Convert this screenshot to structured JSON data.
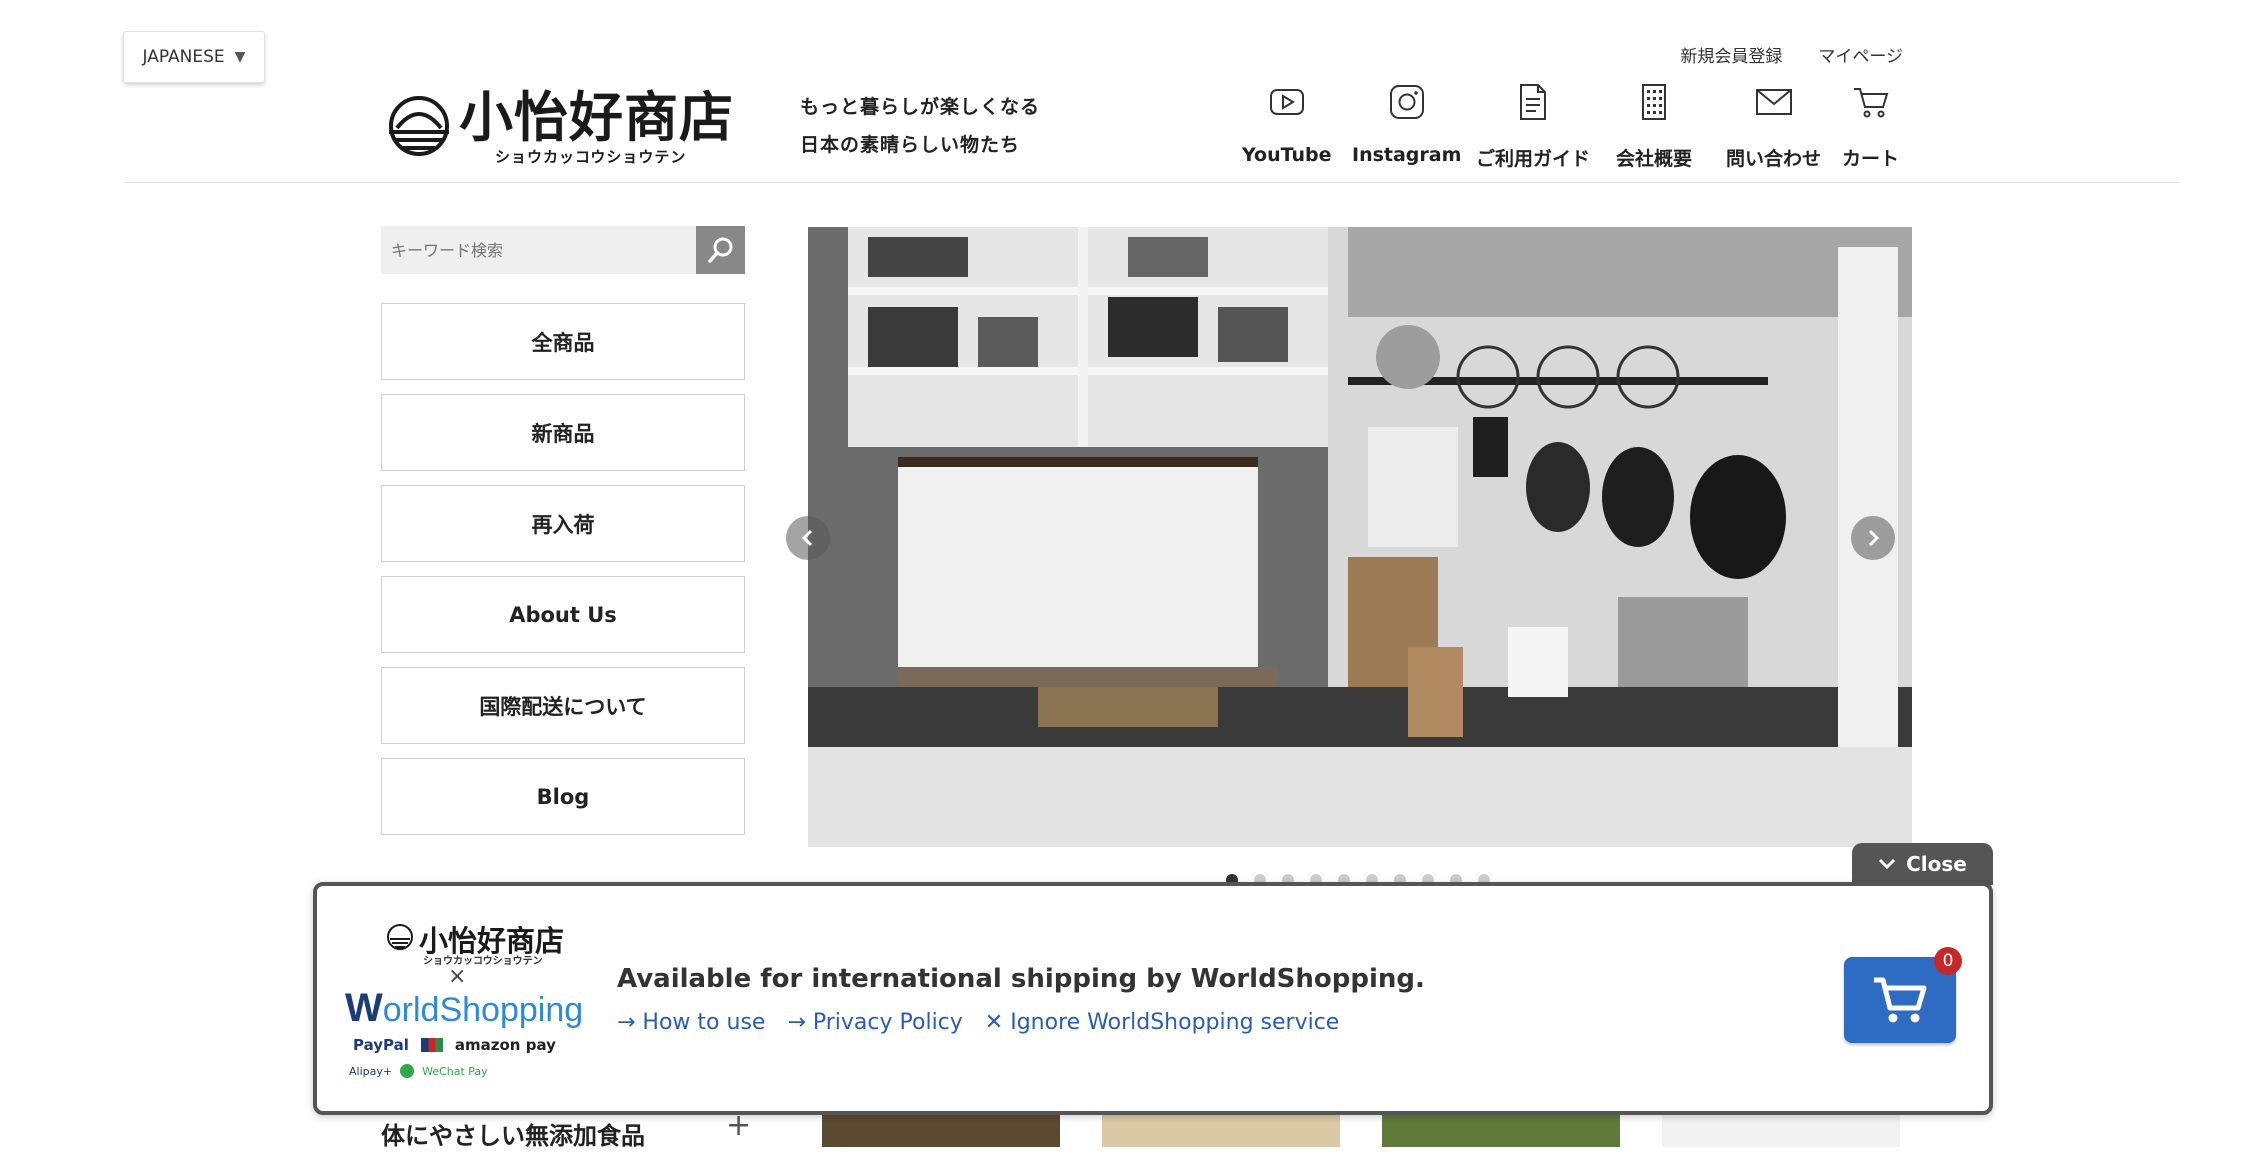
{
  "language": {
    "label": "JAPANESE"
  },
  "logo": {
    "name": "小怡好商店",
    "kana": "ショウカッコウショウテン"
  },
  "tagline": {
    "line1": "もっと暮らしが楽しくなる",
    "line2": "日本の素晴らしい物たち"
  },
  "header": {
    "top_links": [
      "新規会員登録",
      "マイページ"
    ],
    "nav": [
      {
        "label": "YouTube",
        "icon": "youtube-icon"
      },
      {
        "label": "Instagram",
        "icon": "instagram-icon"
      },
      {
        "label": "ご利用ガイド",
        "icon": "guide-document-icon"
      },
      {
        "label": "会社概要",
        "icon": "building-icon"
      },
      {
        "label": "問い合わせ",
        "icon": "mail-icon"
      },
      {
        "label": "カート",
        "icon": "cart-icon"
      }
    ]
  },
  "search": {
    "placeholder": "キーワード検索",
    "icon": "search-icon"
  },
  "sidebar": {
    "items": [
      "全商品",
      "新商品",
      "再入荷",
      "About Us",
      "国際配送について",
      "Blog"
    ]
  },
  "slider": {
    "slide_count": 10,
    "active_index": 0,
    "image": "kitchen-shelves-photo"
  },
  "category": {
    "label": "体にやさしい無添加食品"
  },
  "worldshopping": {
    "close_label": "Close",
    "shop_name": "小怡好商店",
    "shop_kana": "ショウカッコウショウテン",
    "times": "×",
    "logo_prefix": "W",
    "logo_rest": "orldShopping",
    "payments": [
      "PayPal",
      "amazon pay"
    ],
    "payments_small": [
      "Alipay+",
      "WeChat Pay"
    ],
    "headline": "Available for international shipping by WorldShopping.",
    "links": [
      "→ How to use",
      "→ Privacy Policy",
      "✕ Ignore WorldShopping service"
    ],
    "cart_count": "0"
  },
  "colors": {
    "accent_link": "#2a5db0",
    "cart_button": "#2e6bc3",
    "badge": "#c62828",
    "banner_border": "#555555"
  }
}
